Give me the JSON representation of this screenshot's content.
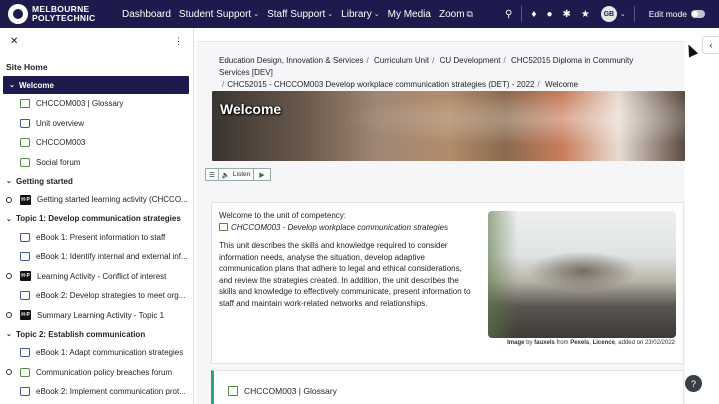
{
  "logo": {
    "line1": "MELBOURNE",
    "line2": "POLYTECHNIC"
  },
  "nav": {
    "items": [
      {
        "label": "Dashboard",
        "dropdown": false
      },
      {
        "label": "Student Support",
        "dropdown": true
      },
      {
        "label": "Staff Support",
        "dropdown": true
      },
      {
        "label": "Library",
        "dropdown": true
      },
      {
        "label": "My Media",
        "dropdown": false
      },
      {
        "label": "Zoom",
        "dropdown": false
      }
    ],
    "avatar_initials": "GB",
    "edit_mode_label": "Edit mode"
  },
  "drawer": {
    "site_home": "Site Home",
    "sections": [
      {
        "title": "Welcome",
        "active": true,
        "items": [
          {
            "label": "CHCCOM003 | Glossary",
            "icon": "glossary"
          },
          {
            "label": "Unit overview",
            "icon": "book"
          },
          {
            "label": "CHCCOM003",
            "icon": "forum"
          },
          {
            "label": "Social forum",
            "icon": "forum"
          }
        ]
      },
      {
        "title": "Getting started",
        "active": false,
        "items": [
          {
            "label": "Getting started learning activity (CHCCO...",
            "icon": "h5p",
            "circle": true
          }
        ]
      },
      {
        "title": "Topic 1: Develop communication strategies",
        "active": false,
        "items": [
          {
            "label": "eBook 1: Present information to staff",
            "icon": "book"
          },
          {
            "label": "eBook 1: Identify internal and external inf...",
            "icon": "book"
          },
          {
            "label": "Learning Activity - Conflict of interest",
            "icon": "h5p",
            "circle": true
          },
          {
            "label": "eBook 2: Develop strategies to meet org...",
            "icon": "book"
          },
          {
            "label": "Summary Learning Activity - Topic 1",
            "icon": "h5p",
            "circle": true
          }
        ]
      },
      {
        "title": "Topic 2: Establish communication",
        "active": false,
        "items": [
          {
            "label": "eBook 1: Adapt communication strategies",
            "icon": "book"
          },
          {
            "label": "Communication policy breaches forum",
            "icon": "forum",
            "circle": true
          },
          {
            "label": "eBook 2: Implement communication prot...",
            "icon": "book"
          }
        ]
      }
    ]
  },
  "breadcrumb": [
    "Education Design, Innovation & Services",
    "Curriculum Unit",
    "CU Development",
    "CHC52015 Diploma in Community Services [DEV]",
    "CHC52015 - CHCCOM003 Develop workplace communication strategies (DET) - 2022",
    "Welcome"
  ],
  "banner": {
    "title": "Welcome"
  },
  "listen": {
    "label": "Listen"
  },
  "content": {
    "intro_line": "Welcome to the unit of competency:",
    "unit_name": "CHCCOM003 - Develop workplace communication strategies",
    "description": "This unit describes the skills and knowledge required to consider information needs, analyse the situation, develop adaptive communication plans that adhere to legal and ethical considerations, and review the strategies created. In addition, the unit describes the skills and knowledge to effectively communicate, present information to staff and maintain work-related networks and relationships.",
    "caption": {
      "prefix": "Image",
      "by": "by",
      "author": "fauxels",
      "from": "from",
      "source": "Pexels",
      "license": "Licence",
      "added": ", added on 23/02/2022"
    }
  },
  "glossary_card": {
    "label": "CHCCOM003 | Glossary"
  },
  "help": {
    "label": "?"
  }
}
